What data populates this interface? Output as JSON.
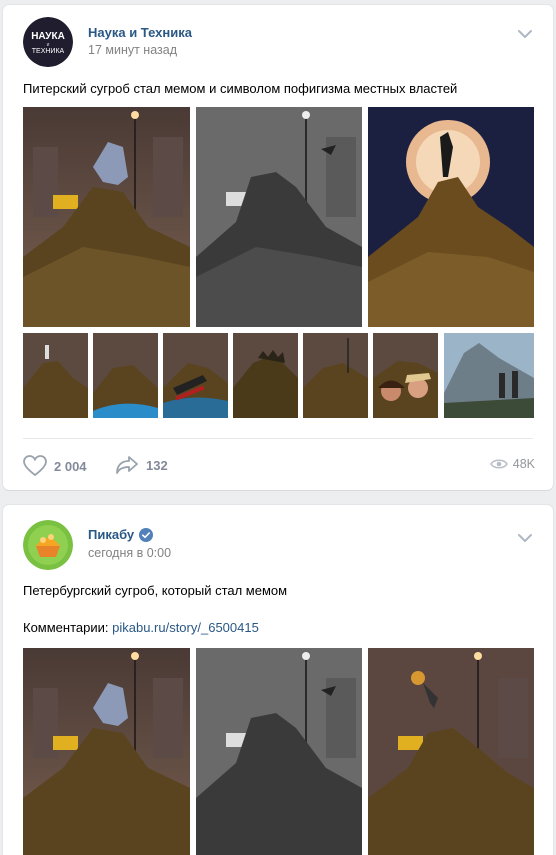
{
  "post1": {
    "author": "Наука и Техника",
    "avatar_text_top": "НАУКА",
    "avatar_text_mid": "и",
    "avatar_text_bottom": "ТЕХНИКА",
    "time": "17 минут назад",
    "text": "Питерский сугроб стал мемом и символом пофигизма местных властей",
    "likes": "2 004",
    "shares": "132",
    "views": "48K",
    "images": [
      "snowdrift-with-horse-statue",
      "snowdrift-grayscale",
      "snowdrift-with-moon",
      "snowdrift-with-figure",
      "snowdrift-with-wave",
      "snowdrift-titanic",
      "snowdrift-godzilla",
      "snowdrift-plain",
      "snowdrift-couple",
      "snowdrift-mountain-explorers"
    ]
  },
  "post2": {
    "author": "Пикабу",
    "verified": true,
    "time": "сегодня в 0:00",
    "text": "Петербургский сугроб, который стал мемом",
    "comments_label": "Комментарии: ",
    "comments_link": "pikabu.ru/story/_6500415",
    "images": [
      "snowdrift-with-horse-statue",
      "snowdrift-grayscale",
      "snowdrift-with-lion-king"
    ]
  },
  "colors": {
    "link": "#2a5885",
    "background": "#edeef0",
    "muted": "#828a99"
  }
}
